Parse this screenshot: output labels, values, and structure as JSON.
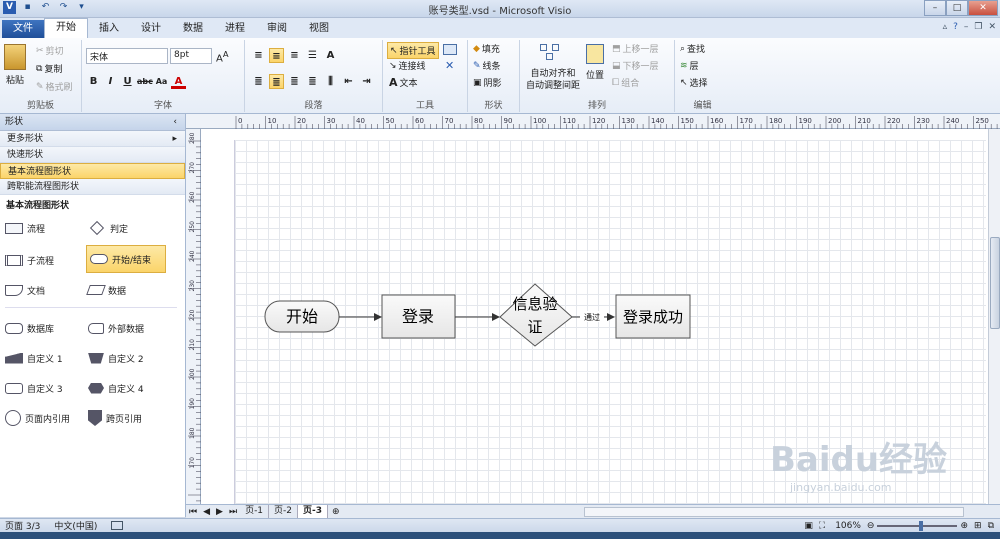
{
  "window": {
    "title": "账号类型.vsd - Microsoft Visio"
  },
  "tabs": [
    "文件",
    "开始",
    "插入",
    "设计",
    "数据",
    "进程",
    "审阅",
    "视图"
  ],
  "ribbon": {
    "clipboard": {
      "label": "剪贴板",
      "paste": "粘贴",
      "cut": "剪切",
      "copy": "复制",
      "format_painter": "格式刷"
    },
    "font": {
      "label": "字体",
      "family": "宋体",
      "size": "8pt"
    },
    "paragraph": {
      "label": "段落"
    },
    "tools": {
      "label": "工具",
      "pointer": "指针工具",
      "connector": "连接线",
      "text": "文本"
    },
    "shape": {
      "label": "形状",
      "fill": "填充",
      "line": "线条",
      "shadow": "阴影"
    },
    "arrange": {
      "label": "排列",
      "auto_align": "自动对齐和",
      "auto_space": "自动调整间距",
      "position": "位置",
      "bring_forward": "上移一层",
      "send_backward": "下移一层",
      "group": "组合"
    },
    "editing": {
      "label": "编辑",
      "find": "查找",
      "layer": "层",
      "select": "选择"
    }
  },
  "shapes_pane": {
    "title": "形状",
    "rows": [
      "更多形状",
      "快速形状",
      "基本流程图形状",
      "跨职能流程图形状"
    ],
    "active_row": "基本流程图形状",
    "stencil_title": "基本流程图形状",
    "masters": [
      "流程",
      "判定",
      "子流程",
      "开始/结束",
      "文档",
      "数据",
      "数据库",
      "外部数据",
      "自定义 1",
      "自定义 2",
      "自定义 3",
      "自定义 4",
      "页面内引用",
      "跨页引用"
    ],
    "active_master": "开始/结束"
  },
  "diagram": {
    "start": "开始",
    "login": "登录",
    "verify_line1": "信息验",
    "verify_line2": "证",
    "pass_label": "通过",
    "success": "登录成功"
  },
  "ruler": {
    "h": [
      "0",
      "10",
      "20",
      "30",
      "40",
      "50",
      "60",
      "70",
      "80",
      "90",
      "100",
      "110",
      "120",
      "130",
      "140",
      "150",
      "160",
      "170",
      "180",
      "190",
      "200",
      "210",
      "220",
      "230",
      "240",
      "250",
      "260"
    ],
    "v": [
      "280",
      "270",
      "260",
      "250",
      "240",
      "230",
      "220",
      "210",
      "200",
      "190",
      "180",
      "170",
      "160",
      "150",
      "140",
      "130",
      "120",
      "110",
      "100",
      "90"
    ]
  },
  "page_tabs": [
    "页-1",
    "页-2",
    "页-3"
  ],
  "active_page": "页-3",
  "status": {
    "page": "页面 3/3",
    "language": "中文(中国)",
    "zoom": "106%"
  },
  "watermark": {
    "logo": "Baidu经验",
    "url": "jingyan.baidu.com"
  }
}
